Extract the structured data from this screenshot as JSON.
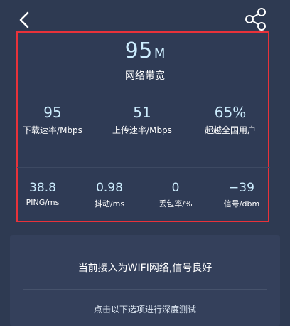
{
  "nav": {
    "back_icon": "chevron-left-icon",
    "share_icon": "share-icon"
  },
  "summary": {
    "bandwidth_value": "95",
    "bandwidth_unit": "M",
    "bandwidth_label": "网络带宽"
  },
  "stats": [
    {
      "value": "95",
      "label": "下载速率/Mbps"
    },
    {
      "value": "51",
      "label": "上传速率/Mbps"
    },
    {
      "value": "65%",
      "label": "超越全国用户"
    }
  ],
  "metrics": [
    {
      "value": "38.8",
      "label": "PING/ms"
    },
    {
      "value": "0.98",
      "label": "抖动/ms"
    },
    {
      "value": "0",
      "label": "丢包率/%"
    },
    {
      "value": "−39",
      "label": "信号/dbm"
    }
  ],
  "info": {
    "status_text": "当前接入为WIFI网络,信号良好",
    "deep_test_link": "点击以下选项进行深度测试"
  },
  "colors": {
    "background": "#2e3a52",
    "highlight_border": "#e8323a",
    "value_text": "#cdeeff"
  }
}
